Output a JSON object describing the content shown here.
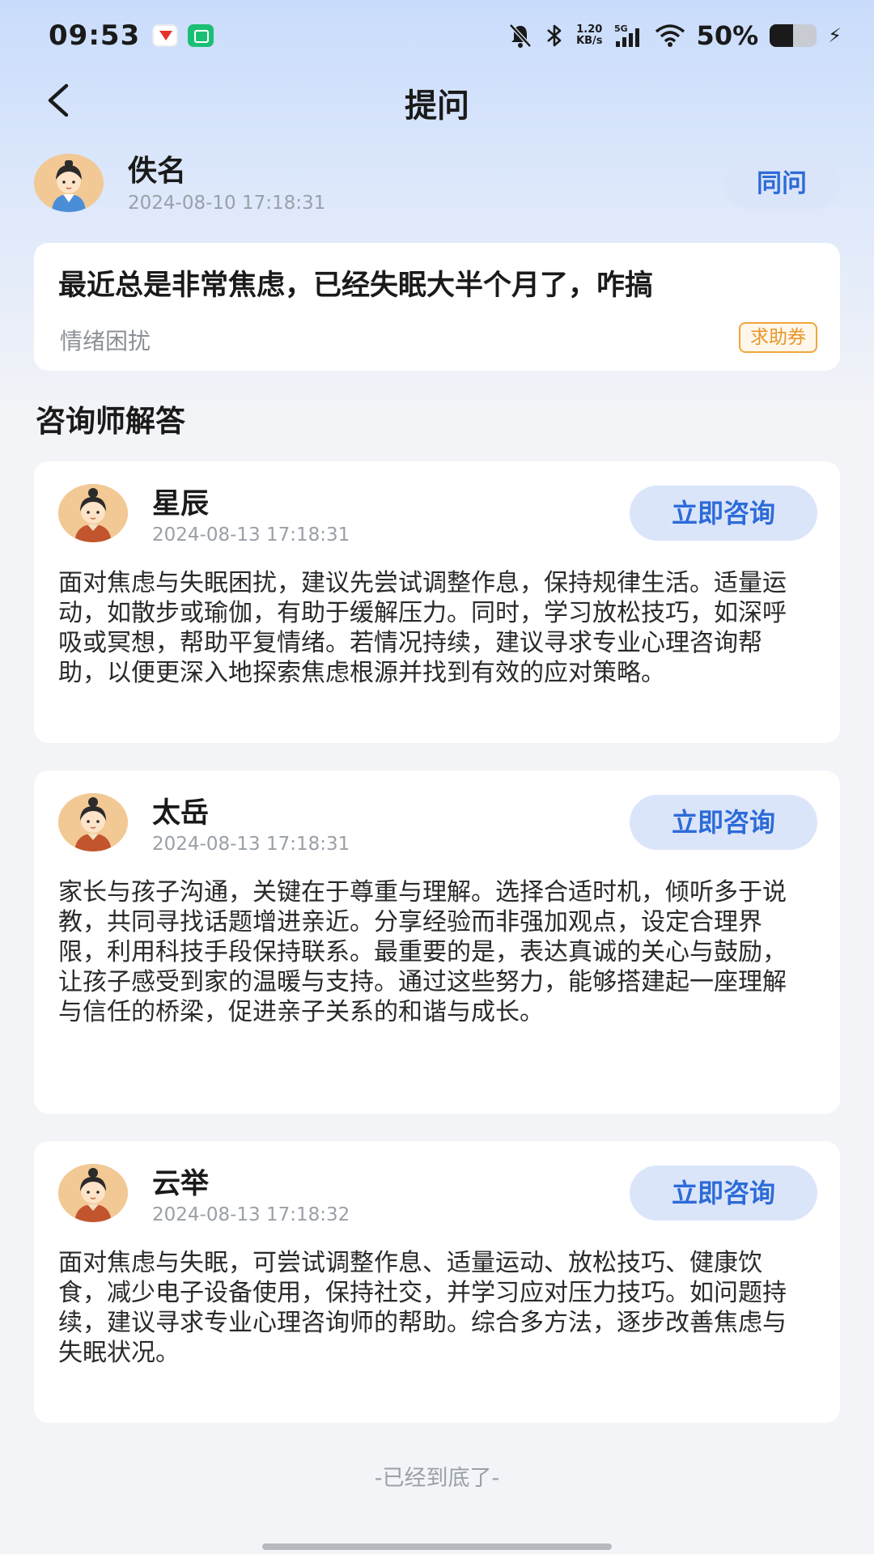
{
  "status_bar": {
    "time": "09:53",
    "net_speed": "1.20",
    "net_speed_unit": "KB/s",
    "network": "5G",
    "battery_percent": "50%",
    "battery_level": 0.5,
    "icons": [
      "red-app-notification-icon",
      "green-app-notification-icon",
      "mute-icon",
      "bluetooth-icon",
      "signal-icon",
      "wifi-icon",
      "battery-icon",
      "charging-icon"
    ]
  },
  "nav": {
    "back_icon": "chevron-left-icon",
    "title": "提问"
  },
  "question": {
    "asker_name": "佚名",
    "asker_time": "2024-08-10 17:18:31",
    "same_question_label": "同问",
    "text": "最近总是非常焦虑，已经失眠大半个月了，咋搞",
    "tag": "情绪困扰",
    "coupon_label": "求助券"
  },
  "answers_section": {
    "title": "咨询师解答"
  },
  "answers": [
    {
      "name": "星辰",
      "time": "2024-08-13 17:18:31",
      "button_label": "立即咨询",
      "body": "面对焦虑与失眠困扰，建议先尝试调整作息，保持规律生活。适量运动，如散步或瑜伽，有助于缓解压力。同时，学习放松技巧，如深呼吸或冥想，帮助平复情绪。若情况持续，建议寻求专业心理咨询帮助，以便更深入地探索焦虑根源并找到有效的应对策略。"
    },
    {
      "name": "太岳",
      "time": "2024-08-13 17:18:31",
      "button_label": "立即咨询",
      "body": "家长与孩子沟通，关键在于尊重与理解。选择合适时机，倾听多于说教，共同寻找话题增进亲近。分享经验而非强加观点，设定合理界限，利用科技手段保持联系。最重要的是，表达真诚的关心与鼓励，让孩子感受到家的温暖与支持。通过这些努力，能够搭建起一座理解与信任的桥梁，促进亲子关系的和谐与成长。"
    },
    {
      "name": "云举",
      "time": "2024-08-13 17:18:32",
      "button_label": "立即咨询",
      "body": "面对焦虑与失眠，可尝试调整作息、适量运动、放松技巧、健康饮食，减少电子设备使用，保持社交，并学习应对压力技巧。如问题持续，建议寻求专业心理咨询师的帮助。综合多方法，逐步改善焦虑与失眠状况。"
    }
  ],
  "footer": {
    "end_text": "-已经到底了-"
  },
  "colors": {
    "accent": "#2d6bd8",
    "button_bg": "#dbe5fa",
    "coupon": "#e8962a",
    "page_bg": "#f3f4f7"
  }
}
